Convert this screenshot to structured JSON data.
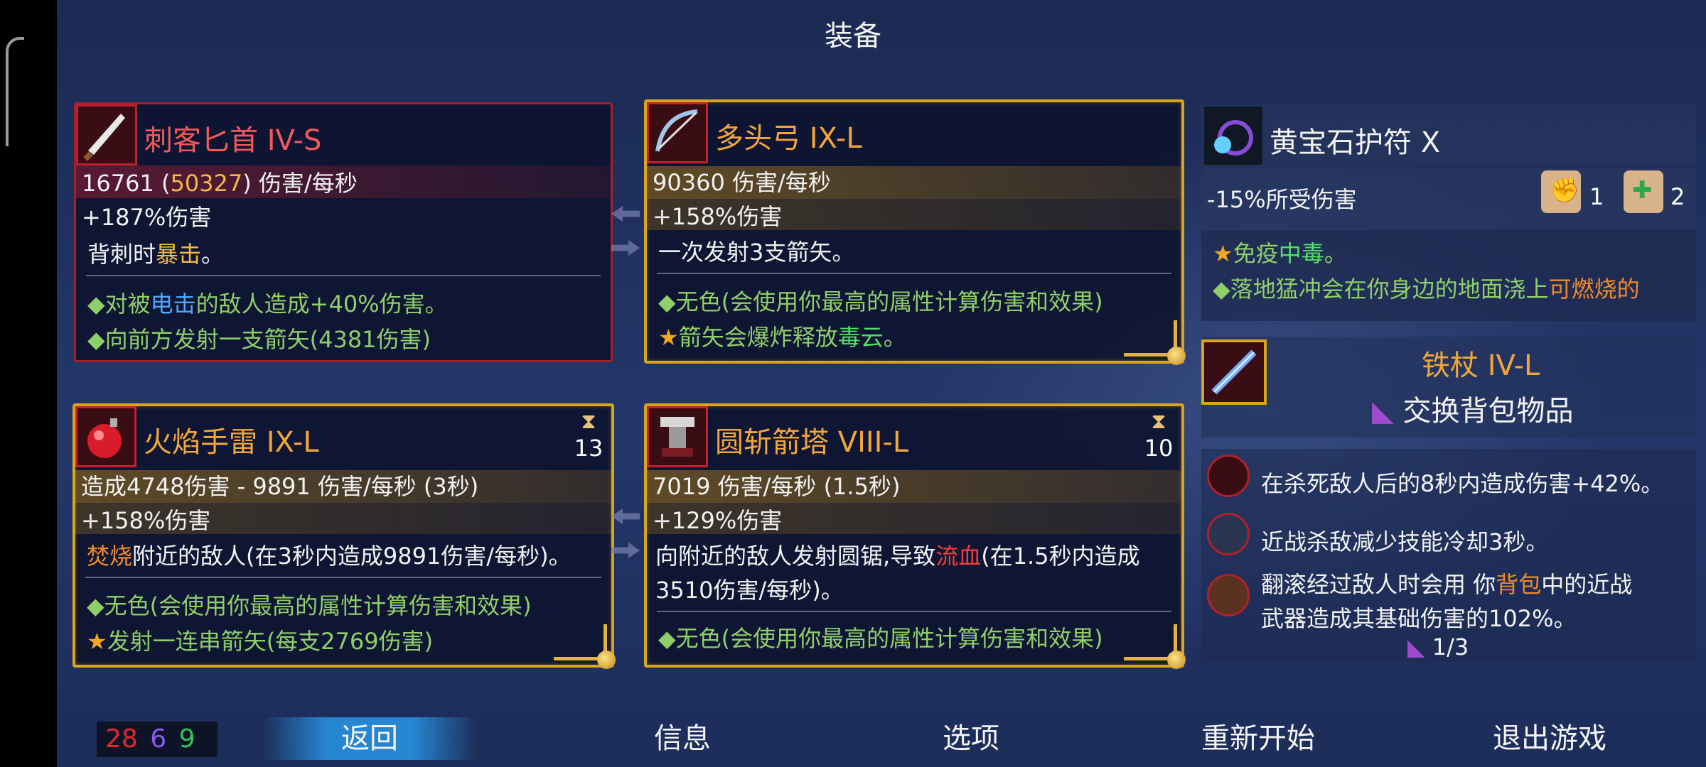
{
  "title": "装备",
  "colors": {
    "red_border": "#a4202a",
    "gold_border": "#d8a51c",
    "accent_blue": "#2896e6"
  },
  "weapon1": {
    "name": "刺客匕首 IV-S",
    "dps": "16761",
    "dps_crit": "50327",
    "dps_unit": "伤害/每秒",
    "bonus": "+187%伤害",
    "desc_pre": "背刺时",
    "desc_hl": "暴击",
    "desc_post": "。",
    "affix1_pre": "对被",
    "affix1_hl": "电击",
    "affix1_post": "的敌人造成+40%伤害。",
    "affix2": "向前方发射一支箭矢(4381伤害)",
    "icon": "dagger-icon"
  },
  "weapon2": {
    "name": "多头弓 IX-L",
    "dps": "90360 伤害/每秒",
    "bonus": "+158%伤害",
    "desc": "一次发射3支箭矢。",
    "affix1": "无色(会使用你最高的属性计算伤害和效果)",
    "affix2_pre": "箭矢会爆炸释放",
    "affix2_hl": "毒云",
    "affix2_post": "。",
    "icon": "bow-icon"
  },
  "skill1": {
    "name": "火焰手雷 IX-L",
    "cooldown": "13",
    "dps": "造成4748伤害 - 9891 伤害/每秒 (3秒)",
    "bonus": "+158%伤害",
    "desc_hl": "焚烧",
    "desc_post": "附近的敌人(在3秒内造成9891伤害/每秒)。",
    "affix1": "无色(会使用你最高的属性计算伤害和效果)",
    "affix2": "发射一连串箭矢(每支2769伤害)",
    "icon": "grenade-icon"
  },
  "skill2": {
    "name": "圆斩箭塔 VIII-L",
    "cooldown": "10",
    "dps": "7019 伤害/每秒 (1.5秒)",
    "bonus": "+129%伤害",
    "desc1_pre": "向附近的敌人发射圆锯,导致",
    "desc1_hl": "流血",
    "desc1_post": "(在1.5秒内造成",
    "desc2": "3510伤害/每秒)。",
    "affix1": "无色(会使用你最高的属性计算伤害和效果)",
    "icon": "turret-icon"
  },
  "amulet": {
    "name": "黄宝石护符 X",
    "stat": "-15%所受伤害",
    "scroll1_count": "1",
    "scroll2_count": "2",
    "affix1_pre": "免疫",
    "affix1_hl": "中毒",
    "affix1_post": "。",
    "affix2_pre": "落地猛冲会在你身边的地面浇上",
    "affix2_hl": "可燃烧的",
    "icon": "amulet-icon"
  },
  "backpack": {
    "name": "铁杖 IV-L",
    "action": "交换背包物品",
    "icon": "staff-icon"
  },
  "mutations": [
    {
      "text": "在杀死敌人后的8秒内造成伤害+42%。",
      "icon": "crossbow-mutation-icon"
    },
    {
      "text": "近战杀敌减少技能冷却3秒。",
      "icon": "blade-mutation-icon"
    },
    {
      "line1_pre": "翻滚经过敌人时会用 你",
      "line1_hl": "背包",
      "line1_post": "中的近战",
      "line2": "武器造成其基础伤害的102%。",
      "icon": "backpack-mutation-icon"
    }
  ],
  "mutation_page": "1/3",
  "scroll_counts": {
    "brutality": "28",
    "tactics": "6",
    "survival": "9"
  },
  "nav": {
    "back": "返回",
    "info": "信息",
    "options": "选项",
    "restart": "重新开始",
    "quit": "退出游戏"
  }
}
